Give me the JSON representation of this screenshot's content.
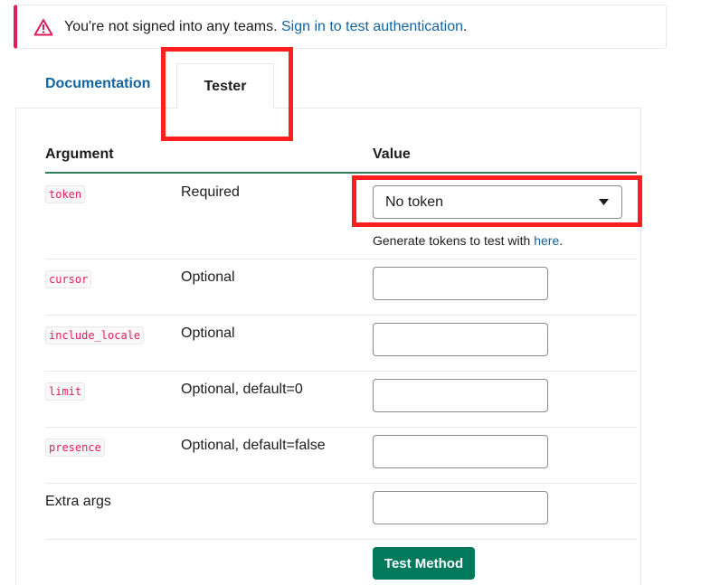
{
  "alert": {
    "message": "You're not signed into any teams.",
    "link": "Sign in to test authentication",
    "suffix": "."
  },
  "tabs": {
    "documentation": "Documentation",
    "tester": "Tester"
  },
  "table": {
    "header_argument": "Argument",
    "header_value": "Value",
    "rows": [
      {
        "name": "token",
        "requirement": "Required"
      },
      {
        "name": "cursor",
        "requirement": "Optional"
      },
      {
        "name": "include_locale",
        "requirement": "Optional"
      },
      {
        "name": "limit",
        "requirement": "Optional, default=0"
      },
      {
        "name": "presence",
        "requirement": "Optional, default=false"
      }
    ],
    "extra_args": "Extra args"
  },
  "token_select": {
    "value": "No token",
    "helper_prefix": "Generate tokens to test with",
    "helper_link": "here",
    "helper_suffix": "."
  },
  "actions": {
    "test_method": "Test Method"
  },
  "colors": {
    "alert_border": "#e01e5a",
    "link": "#1264a3",
    "button": "#007a5a",
    "highlight": "#ff1f1f"
  }
}
